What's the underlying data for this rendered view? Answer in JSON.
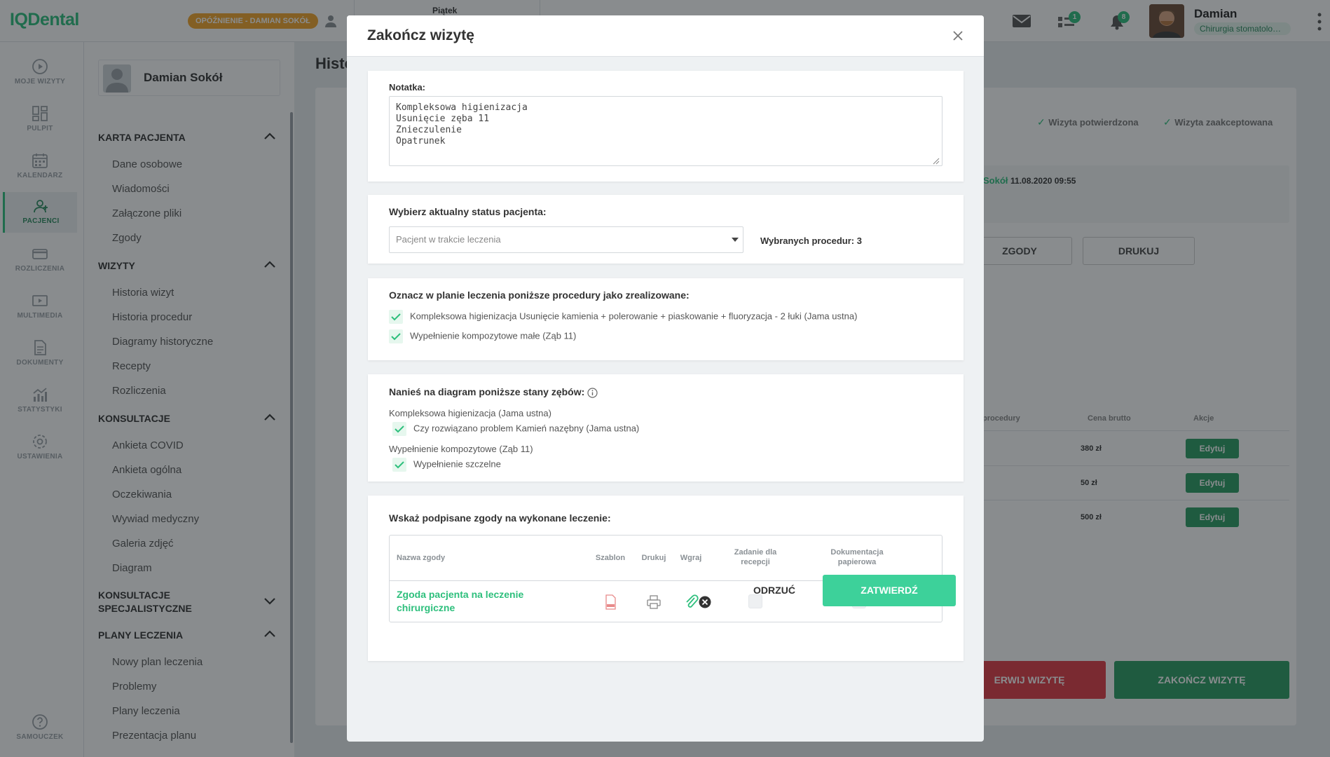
{
  "app": {
    "logo": "IQDental",
    "delay_badge": "OPÓŹNIENIE - DAMIAN SOKÓŁ",
    "date_label": "Piątek"
  },
  "user": {
    "name": "Damian",
    "role": "Chirurgia stomatologi...",
    "tasks_count": "1",
    "notifications_count": "8"
  },
  "rail": [
    {
      "label": "MOJE WIZYTY",
      "icon": "play-circle-icon"
    },
    {
      "label": "PULPIT",
      "icon": "dashboard-icon"
    },
    {
      "label": "KALENDARZ",
      "icon": "calendar-icon"
    },
    {
      "label": "PACJENCI",
      "icon": "patients-icon",
      "active": true
    },
    {
      "label": "ROZLICZENIA",
      "icon": "billing-icon"
    },
    {
      "label": "MULTIMEDIA",
      "icon": "multimedia-icon"
    },
    {
      "label": "DOKUMENTY",
      "icon": "document-icon"
    },
    {
      "label": "STATYSTYKI",
      "icon": "stats-icon"
    },
    {
      "label": "USTAWIENIA",
      "icon": "settings-icon"
    },
    {
      "label": "SAMOUCZEK",
      "icon": "help-icon"
    }
  ],
  "sidebar": {
    "patient_name": "Damian Sokół",
    "sections": [
      {
        "title": "KARTA PACJENTA",
        "items": [
          "Dane osobowe",
          "Wiadomości",
          "Załączone pliki",
          "Zgody"
        ]
      },
      {
        "title": "WIZYTY",
        "items": [
          "Historia wizyt",
          "Historia procedur",
          "Diagramy historyczne",
          "Recepty",
          "Rozliczenia"
        ]
      },
      {
        "title": "KONSULTACJE",
        "items": [
          "Ankieta COVID",
          "Ankieta ogólna",
          "Oczekiwania",
          "Wywiad medyczny",
          "Galeria zdjęć",
          "Diagram"
        ]
      },
      {
        "title": "KONSULTACJE SPECJALISTYCZNE",
        "items": []
      },
      {
        "title": "PLANY LECZENIA",
        "items": [
          "Nowy plan leczenia",
          "Problemy",
          "Plany leczenia",
          "Prezentacja planu"
        ]
      }
    ]
  },
  "background": {
    "title": "Histo",
    "chk_confirmed": "Wizyta potwierdzona",
    "chk_accepted": "Wizyta zaakceptowana",
    "info_name": "Sokół",
    "info_date": "11.08.2020 09:55",
    "btn_consents": "ZGODY",
    "btn_print": "DRUKUJ",
    "col_procedure": "procedury",
    "col_price": "Cena brutto",
    "col_actions": "Akcje",
    "prices": [
      "380 zł",
      "50 zł",
      "500 zł"
    ],
    "edit_label": "Edytuj",
    "btn_interrupt": "ERWIJ WIZYTĘ",
    "btn_finish": "ZAKOŃCZ WIZYTĘ"
  },
  "modal": {
    "title": "Zakończ wizytę",
    "note_label": "Notatka:",
    "note_value": "Kompleksowa higienizacja\nUsunięcie zęba 11\nZnieczulenie\nOpatrunek",
    "status_label": "Wybierz aktualny status pacjenta:",
    "status_value": "Pacjent w trakcie leczenia",
    "procedures_count": "Wybranych procedur: 3",
    "plan_label": "Oznacz w planie leczenia poniższe procedury jako zrealizowane:",
    "plan_items": [
      "Kompleksowa higienizacja Usunięcie kamienia + polerowanie + piaskowanie + fluoryzacja - 2 łuki (Jama ustna)",
      "Wypełnienie kompozytowe małe (Ząb 11)"
    ],
    "diagram_label": "Nanieś na diagram poniższe stany zębów:",
    "diagram_groups": [
      {
        "title": "Kompleksowa higienizacja (Jama ustna)",
        "item": "Czy rozwiązano problem Kamień nazębny (Jama ustna)"
      },
      {
        "title": "Wypełnienie kompozytowe (Ząb 11)",
        "item": "Wypełnienie szczelne"
      }
    ],
    "consent_label": "Wskaż podpisane zgody na wykonane leczenie:",
    "table_headers": {
      "name": "Nazwa zgody",
      "template": "Szablon",
      "print": "Drukuj",
      "upload": "Wgraj",
      "reception_task": "Zadanie dla recepcji",
      "paper_docs": "Dokumentacja papierowa"
    },
    "consent_name": "Zgoda pacjenta na leczenie chirurgiczne",
    "btn_reject": "ODRZUĆ",
    "btn_confirm": "ZATWIERDŹ"
  },
  "colors": {
    "accent": "#2dbf7c",
    "warning": "#f3a52a",
    "danger": "#e03a45",
    "dark_green": "#1f8f5c"
  }
}
